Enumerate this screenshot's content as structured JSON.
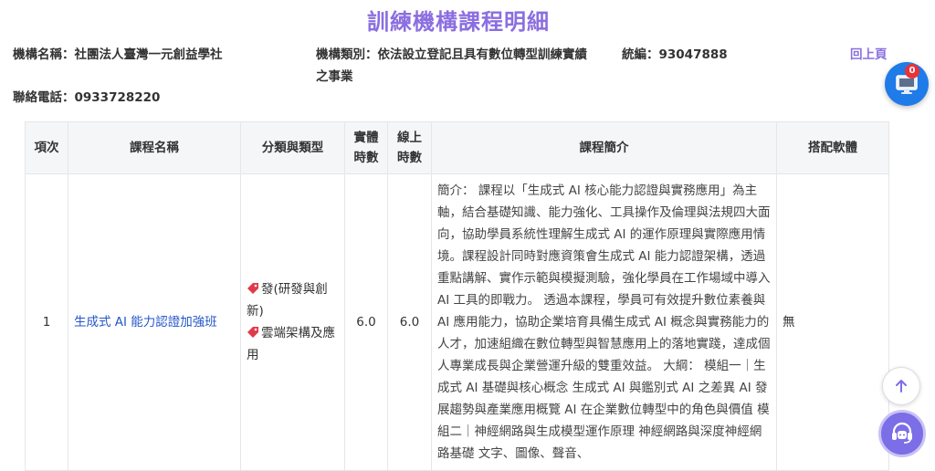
{
  "page": {
    "title": "訓練機構課程明細",
    "back_label": "回上頁"
  },
  "institution": {
    "name": "機構名稱：社團法人臺灣一元創益學社",
    "category": "機構類別：依法設立登記且具有數位轉型訓練實績之事業",
    "tax_id": "統編：93047888",
    "phone": "聯絡電話：0933728220"
  },
  "floating": {
    "badge_count": "0",
    "monitor_icon": "monitor-icon",
    "scroll_top_icon": "arrow-up-icon",
    "support_icon": "headset-icon"
  },
  "table": {
    "headers": {
      "no": "項次",
      "name": "課程名稱",
      "category": "分類與類型",
      "physical": "實體時數",
      "online": "線上時數",
      "intro": "課程簡介",
      "software": "搭配軟體"
    },
    "rows": [
      {
        "no": "1",
        "name": "生成式 AI 能力認證加強班",
        "tags": [
          "發(研發與創新)",
          "雲端架構及應用"
        ],
        "physical": "6.0",
        "online": "6.0",
        "intro": "簡介： 課程以「生成式 AI 核心能力認證與實務應用」為主軸，結合基礎知識、能力強化、工具操作及倫理與法規四大面向，協助學員系統性理解生成式 AI 的運作原理與實際應用情境。課程設計同時對應資策會生成式 AI 能力認證架構，透過重點講解、實作示範與模擬測驗，強化學員在工作場域中導入 AI 工具的即戰力。 透過本課程，學員可有效提升數位素養與 AI 應用能力，協助企業培育具備生成式 AI 概念與實務能力的人才，加速組織在數位轉型與智慧應用上的落地實踐，達成個人專業成長與企業營運升級的雙重效益。 大綱： 模組一｜生成式 AI 基礎與核心概念 生成式 AI 與鑑別式 AI 之差異 AI 發展趨勢與產業應用概覽 AI 在企業數位轉型中的角色與價值 模組二｜神經網路與生成模型運作原理 神經網路與深度神經網路基礎 文字、圖像、聲音、",
        "software": "無"
      }
    ]
  },
  "colors": {
    "accent": "#8b6ee0",
    "link": "#2456c8",
    "badge": "#e8323a",
    "monitor_button": "#1e7be8",
    "support_button": "#7b6ee6"
  }
}
